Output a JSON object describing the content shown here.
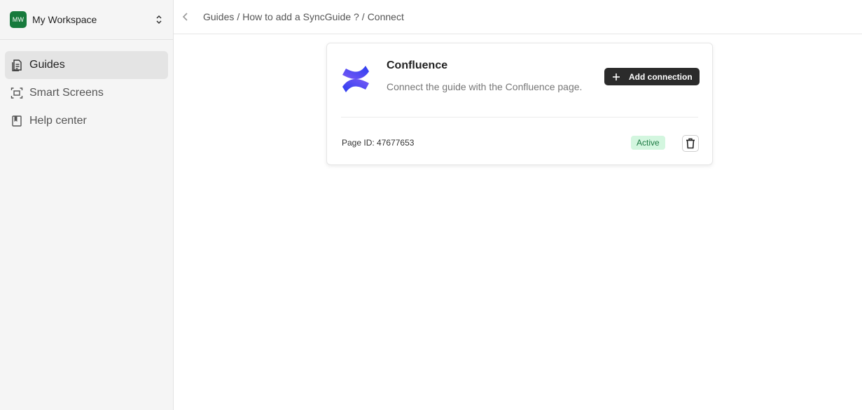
{
  "workspace": {
    "avatar_initials": "MW",
    "name": "My Workspace",
    "avatar_color": "#177a3c",
    "switch_icon": "chevron-up-down-icon"
  },
  "sidebar": {
    "items": [
      {
        "label": "Guides",
        "icon": "document-icon",
        "active": true
      },
      {
        "label": "Smart Screens",
        "icon": "screen-capture-icon",
        "active": false
      },
      {
        "label": "Help center",
        "icon": "book-icon",
        "active": false
      }
    ]
  },
  "header": {
    "back_icon": "chevron-left-icon",
    "breadcrumb": [
      {
        "label": "Guides"
      },
      {
        "label": "How to add a SyncGuide ?"
      },
      {
        "label": "Connect"
      }
    ],
    "separator": "/"
  },
  "card": {
    "logo_icon": "confluence-logo-icon",
    "title": "Confluence",
    "description": "Connect the guide with the Confluence page.",
    "add_button_label": "Add connection",
    "page_id_text": "Page ID: 47677653",
    "status_label": "Active",
    "status_color": "#d3f6df",
    "delete_icon": "trash-icon"
  }
}
